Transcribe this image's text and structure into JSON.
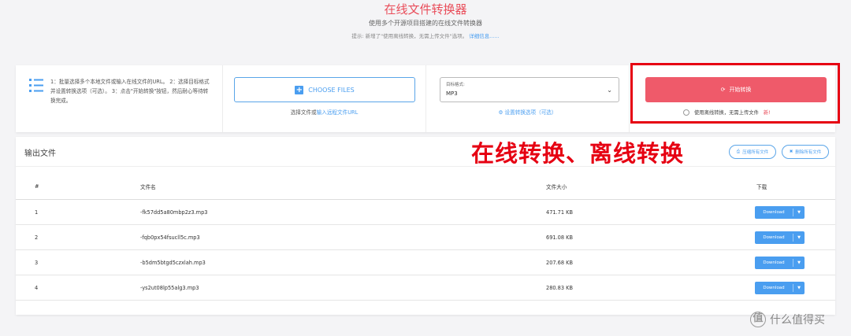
{
  "header": {
    "title": "在线文件转换器",
    "subtitle": "使用多个开源项目搭建的在线文件转换器",
    "tip": "提示: 新增了\"使用离线转换，无需上传文件\"选项。",
    "tip_link": "详细信息......"
  },
  "converter": {
    "instructions": "1：批量选择多个本地文件或输入在线文件的URL。 2：选择目标格式并设置转换选项（可选）。 3：点击\"开始转换\"按钮，然后耐心等待转换完成。",
    "choose_files_label": "CHOOSE FILES",
    "choose_hint_prefix": "选择文件或",
    "choose_hint_link": "输入远程文件URL",
    "format_label": "目标格式:",
    "format_value": "MP3",
    "format_options_link": "设置转换选项（可选）",
    "start_label": "开始转换",
    "offline_label": "使用离线转换，无需上传文件",
    "offline_badge": "新!"
  },
  "annotation_text": "在线转换、离线转换",
  "output": {
    "title": "输出文件",
    "compress_all_label": "压缩所有文件",
    "delete_all_label": "删除所有文件",
    "columns": {
      "num": "#",
      "name": "文件名",
      "size": "文件大小",
      "download": "下载"
    },
    "rows": [
      {
        "num": "1",
        "name": "-fk57dd5a80mbp2z3.mp3",
        "size": "471.71 KB",
        "download": "Download"
      },
      {
        "num": "2",
        "name": "-fqb0px54fsucll5c.mp3",
        "size": "691.08 KB",
        "download": "Download"
      },
      {
        "num": "3",
        "name": "-b5dm5btgd5czxlah.mp3",
        "size": "207.68 KB",
        "download": "Download"
      },
      {
        "num": "4",
        "name": "-ys2ut08lp55alg3.mp3",
        "size": "280.83 KB",
        "download": "Download"
      }
    ]
  },
  "watermark": {
    "icon": "值",
    "text": "什么值得买"
  },
  "colors": {
    "accent": "#4a9ef0",
    "danger": "#ef5a6a",
    "highlight": "#e60012"
  }
}
